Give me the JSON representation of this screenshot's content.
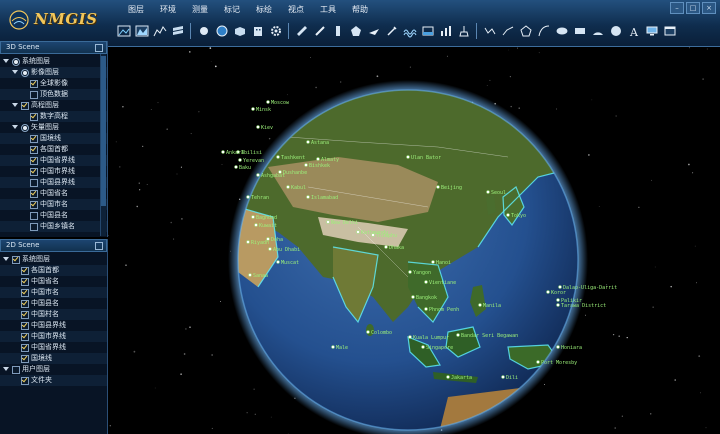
{
  "app": {
    "title": "NMGIS"
  },
  "menu": [
    "图层",
    "环境",
    "测量",
    "标记",
    "标绘",
    "视点",
    "工具",
    "帮助"
  ],
  "window_controls": [
    "–",
    "□",
    "×"
  ],
  "toolbar_icons": [
    "image-layer-icon",
    "terrain-layer-icon",
    "line-chart-icon",
    "layers-icon",
    "sphere-icon",
    "globe-icon",
    "box-icon",
    "building-icon",
    "gear-icon",
    "ruler-icon",
    "pencil-icon",
    "bar-icon",
    "pentagon-icon",
    "fly-icon",
    "pin-edit-icon",
    "wave-icon",
    "flood-icon",
    "chart-icon",
    "clean-icon",
    "polyline-icon",
    "curve-icon",
    "pentagon-outline-icon",
    "arc-icon",
    "ellipse-icon",
    "rectangle-icon",
    "sector-icon",
    "circle-icon",
    "text-icon",
    "screen-icon",
    "window-icon"
  ],
  "panel_3d": {
    "title": "3D Scene",
    "items": [
      {
        "label": "系统图层",
        "depth": 0,
        "type": "radio",
        "checked": true,
        "expanded": true
      },
      {
        "label": "影像图层",
        "depth": 1,
        "type": "radio",
        "checked": true,
        "expanded": true
      },
      {
        "label": "全球影像",
        "depth": 2,
        "type": "check",
        "checked": true
      },
      {
        "label": "顶色数据",
        "depth": 2,
        "type": "check",
        "checked": false
      },
      {
        "label": "高程图层",
        "depth": 1,
        "type": "check",
        "checked": true,
        "expanded": true
      },
      {
        "label": "数字高程",
        "depth": 2,
        "type": "check",
        "checked": true
      },
      {
        "label": "矢量图层",
        "depth": 1,
        "type": "radio",
        "checked": true,
        "expanded": true
      },
      {
        "label": "国境线",
        "depth": 2,
        "type": "check",
        "checked": true
      },
      {
        "label": "各国首都",
        "depth": 2,
        "type": "check",
        "checked": true
      },
      {
        "label": "中国省界线",
        "depth": 2,
        "type": "check",
        "checked": true
      },
      {
        "label": "中国市界线",
        "depth": 2,
        "type": "check",
        "checked": true
      },
      {
        "label": "中国县界线",
        "depth": 2,
        "type": "check",
        "checked": false
      },
      {
        "label": "中国省名",
        "depth": 2,
        "type": "check",
        "checked": true
      },
      {
        "label": "中国市名",
        "depth": 2,
        "type": "check",
        "checked": true
      },
      {
        "label": "中国县名",
        "depth": 2,
        "type": "check",
        "checked": false
      },
      {
        "label": "中国乡镇名",
        "depth": 2,
        "type": "check",
        "checked": false
      }
    ]
  },
  "panel_2d": {
    "title": "2D Scene",
    "items": [
      {
        "label": "系统图层",
        "depth": 0,
        "type": "check",
        "checked": true,
        "expanded": true
      },
      {
        "label": "各国首都",
        "depth": 1,
        "type": "check",
        "checked": true
      },
      {
        "label": "中国省名",
        "depth": 1,
        "type": "check",
        "checked": true
      },
      {
        "label": "中国市名",
        "depth": 1,
        "type": "check",
        "checked": true
      },
      {
        "label": "中国县名",
        "depth": 1,
        "type": "check",
        "checked": true
      },
      {
        "label": "中国村名",
        "depth": 1,
        "type": "check",
        "checked": true
      },
      {
        "label": "中国县界线",
        "depth": 1,
        "type": "check",
        "checked": true
      },
      {
        "label": "中国市界线",
        "depth": 1,
        "type": "check",
        "checked": true
      },
      {
        "label": "中国省界线",
        "depth": 1,
        "type": "check",
        "checked": true
      },
      {
        "label": "国境线",
        "depth": 1,
        "type": "check",
        "checked": true
      },
      {
        "label": "用户图层",
        "depth": 0,
        "type": "check",
        "checked": false,
        "expanded": true
      },
      {
        "label": "文件夹",
        "depth": 1,
        "type": "check",
        "checked": true
      }
    ]
  },
  "globe_labels": [
    "Ulan Bator",
    "Beijing",
    "Seoul",
    "Tokyo",
    "Islamabad",
    "New Delhi",
    "Kathmandu",
    "Thimphu",
    "Dhaka",
    "Yangon",
    "Hanoi",
    "Vientiane",
    "Bangkok",
    "Phnom Penh",
    "Kuala Lumpur",
    "Singapore",
    "Jakarta",
    "Manila",
    "Bandar Seri Begawan",
    "Dili",
    "Port Moresby",
    "Koror",
    "Palikir",
    "Tarawa District",
    "Dalap-Uliga-Darrit",
    "Honiara",
    "Colombo",
    "Male",
    "Tashkent",
    "Kabul",
    "Dushanbe",
    "Bishkek",
    "Almaty",
    "Astana",
    "Ashgabat",
    "Tehran",
    "Baku",
    "Tbilisi",
    "Yerevan",
    "Ankara",
    "Baghdad",
    "Riyadh",
    "Sanaa",
    "Muscat",
    "Kuwait",
    "Doha",
    "Abu Dhabi",
    "Moscow",
    "Minsk",
    "Kiev"
  ],
  "colors": {
    "header_top": "#23507e",
    "header_bottom": "#0a1f38",
    "panel_bg": "#081425",
    "accent": "#f1c65a",
    "label_green": "#9cf07a",
    "border_cyan": "#5ff0ff"
  }
}
